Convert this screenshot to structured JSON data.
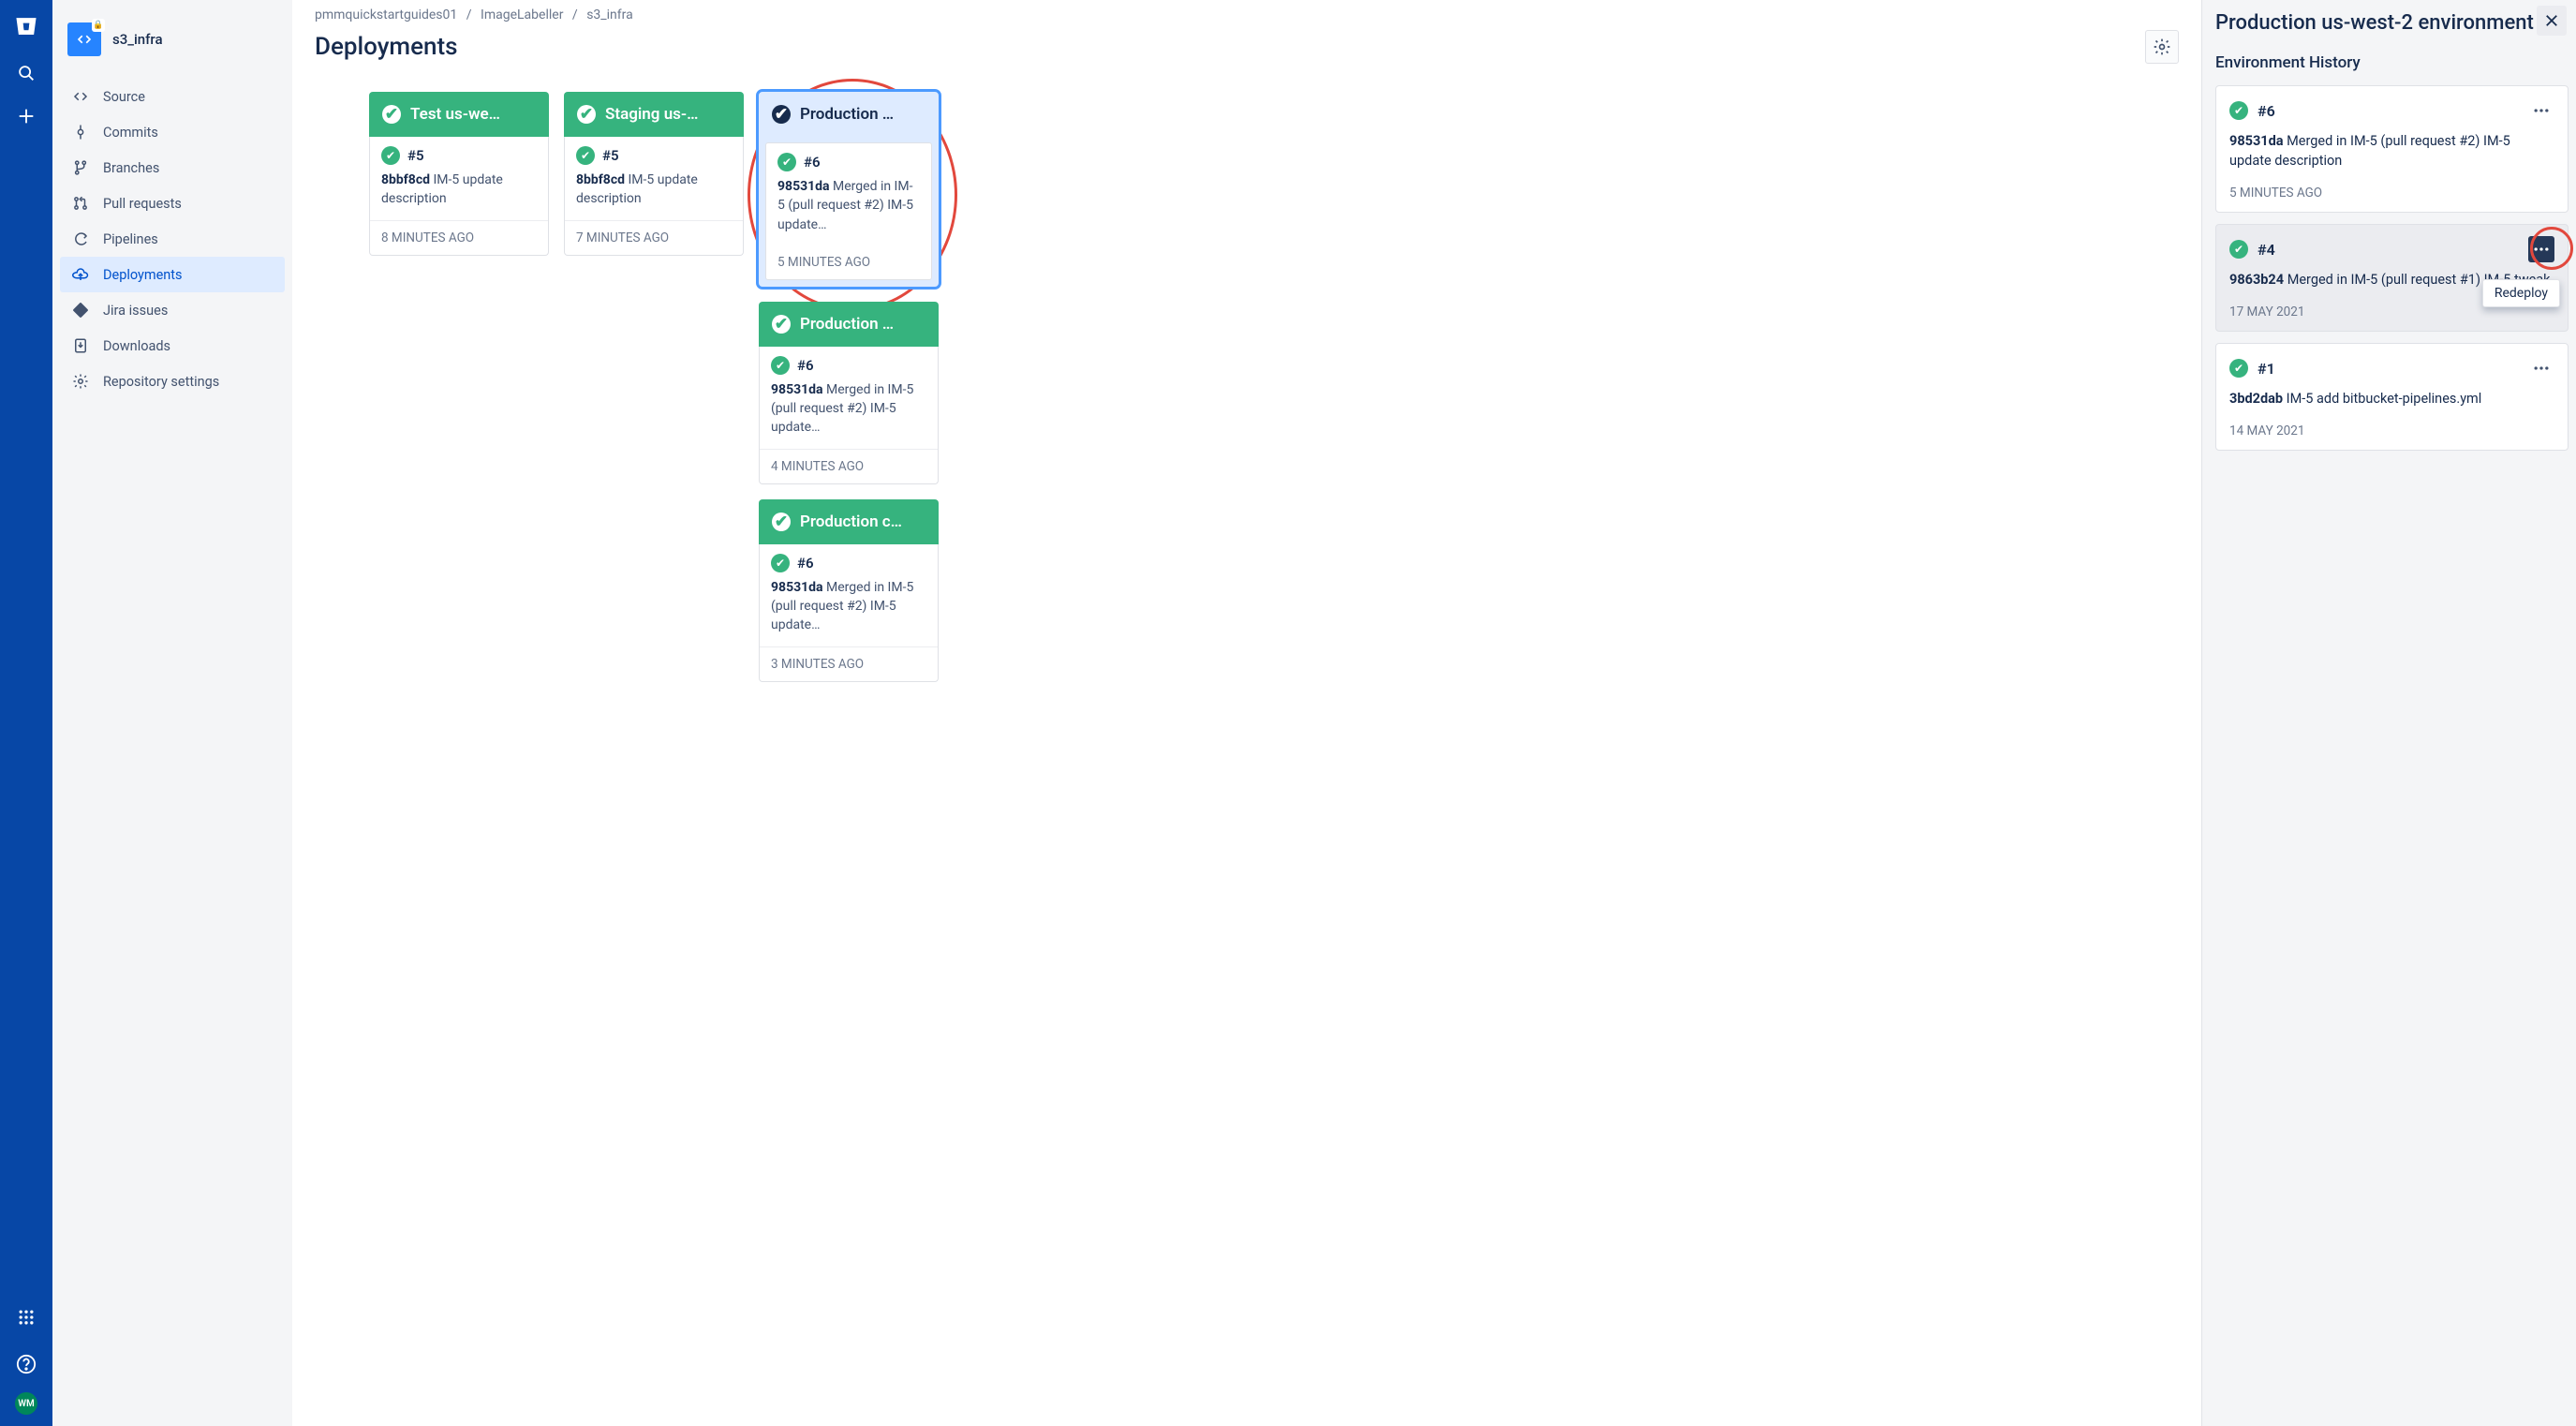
{
  "rail": {
    "avatar_initials": "WM"
  },
  "repo": {
    "name": "s3_infra"
  },
  "sidebar": {
    "items": [
      {
        "label": "Source"
      },
      {
        "label": "Commits"
      },
      {
        "label": "Branches"
      },
      {
        "label": "Pull requests"
      },
      {
        "label": "Pipelines"
      },
      {
        "label": "Deployments"
      },
      {
        "label": "Jira issues"
      },
      {
        "label": "Downloads"
      },
      {
        "label": "Repository settings"
      }
    ]
  },
  "breadcrumbs": {
    "a": "pmmquickstartguides01",
    "b": "ImageLabeller",
    "c": "s3_infra"
  },
  "page": {
    "title": "Deployments"
  },
  "columns": [
    {
      "name": "Test us-we…",
      "cards": [
        {
          "build": "#5",
          "hash": "8bbf8cd",
          "msg": "IM-5 update description",
          "time": "8 MINUTES AGO"
        }
      ]
    },
    {
      "name": "Staging us-…",
      "cards": [
        {
          "build": "#5",
          "hash": "8bbf8cd",
          "msg": "IM-5 update description",
          "time": "7 MINUTES AGO"
        }
      ]
    },
    {
      "name": "Production …",
      "selected": true,
      "cards": [
        {
          "build": "#6",
          "hash": "98531da",
          "msg": "Merged in IM-5 (pull request #2) IM-5 update…",
          "time": "5 MINUTES AGO"
        }
      ]
    },
    {
      "name": "Production …",
      "cards": [
        {
          "build": "#6",
          "hash": "98531da",
          "msg": "Merged in IM-5 (pull request #2) IM-5 update…",
          "time": "4 MINUTES AGO"
        }
      ]
    },
    {
      "name": "Production c…",
      "cards": [
        {
          "build": "#6",
          "hash": "98531da",
          "msg": "Merged in IM-5 (pull request #2) IM-5 update…",
          "time": "3 MINUTES AGO"
        }
      ]
    }
  ],
  "panel": {
    "title": "Production us-west-2 environment",
    "subtitle": "Environment History",
    "tooltip": "Redeploy",
    "history": [
      {
        "build": "#6",
        "hash": "98531da",
        "msg": "Merged in IM-5 (pull request #2) IM-5 update description",
        "time": "5 MINUTES AGO"
      },
      {
        "build": "#4",
        "hash": "9863b24",
        "msg": "Merged in IM-5 (pull request #1) IM-5 tweak",
        "time": "17 MAY 2021"
      },
      {
        "build": "#1",
        "hash": "3bd2dab",
        "msg": "IM-5 add bitbucket-pipelines.yml",
        "time": "14 MAY 2021"
      }
    ]
  }
}
